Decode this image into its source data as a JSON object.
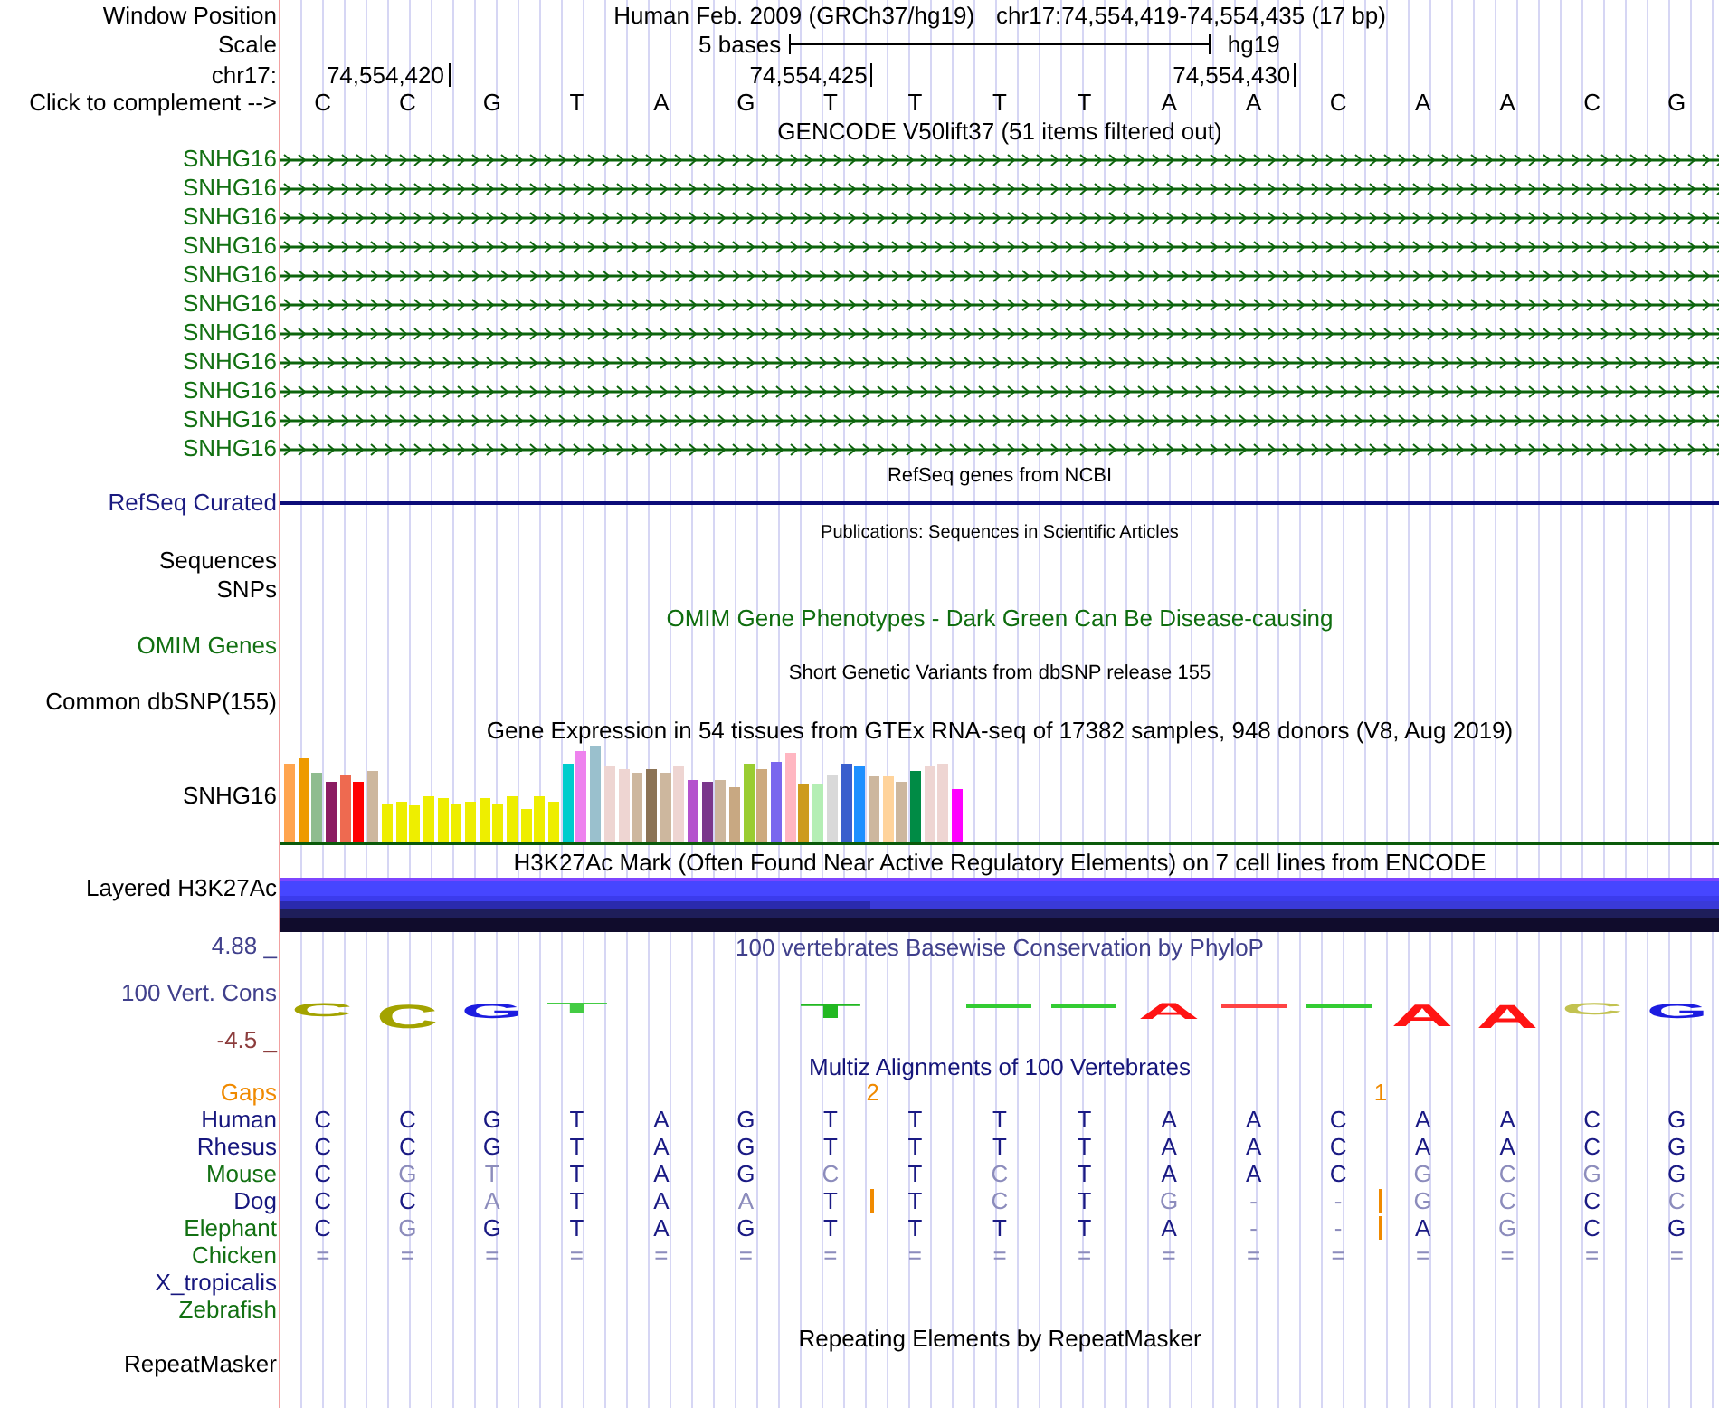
{
  "header": {
    "window_position": {
      "label": "Window Position",
      "assembly": "Human Feb. 2009 (GRCh37/hg19)",
      "range": "chr17:74,554,419-74,554,435 (17 bp)"
    },
    "scale": {
      "label": "Scale",
      "span": "5 bases",
      "assembly": "hg19"
    },
    "coordinates": {
      "label": "chr17:",
      "ticks": [
        "74,554,420",
        "74,554,425",
        "74,554,430"
      ]
    },
    "sequence": {
      "label": "Click to complement -->",
      "bases": [
        "C",
        "C",
        "G",
        "T",
        "A",
        "G",
        "T",
        "T",
        "T",
        "T",
        "A",
        "A",
        "C",
        "A",
        "A",
        "C",
        "G"
      ]
    }
  },
  "tracks": [
    {
      "kind": "gencode",
      "title": "GENCODE V50lift37 (51 items filtered out)",
      "items": [
        {
          "label": "SNHG16",
          "reverse_strand": false
        },
        {
          "label": "SNHG16",
          "reverse_strand": false
        },
        {
          "label": "SNHG16",
          "reverse_strand": false
        },
        {
          "label": "SNHG16",
          "reverse_strand": false
        },
        {
          "label": "SNHG16",
          "reverse_strand": false
        },
        {
          "label": "SNHG16",
          "reverse_strand": false
        },
        {
          "label": "SNHG16",
          "reverse_strand": false
        },
        {
          "label": "SNHG16",
          "reverse_strand": false
        },
        {
          "label": "SNHG16",
          "reverse_strand": false
        },
        {
          "label": "SNHG16",
          "reverse_strand": false
        },
        {
          "label": "SNHG16",
          "reverse_strand": false
        }
      ]
    },
    {
      "kind": "refseq",
      "title": "RefSeq genes from NCBI",
      "labels": [
        "RefSeq Curated"
      ]
    },
    {
      "kind": "pubs",
      "title": "Publications: Sequences in Scientific Articles",
      "labels": [
        "Sequences",
        "SNPs"
      ]
    },
    {
      "kind": "omim",
      "title": "OMIM Gene Phenotypes - Dark Green Can Be Disease-causing",
      "labels": [
        "OMIM Genes"
      ]
    },
    {
      "kind": "dbsnp",
      "title": "Short Genetic Variants from dbSNP release 155",
      "labels": [
        "Common dbSNP(155)"
      ]
    },
    {
      "kind": "gtex",
      "title": "Gene Expression in 54 tissues from GTEx RNA-seq of 17382 samples, 948 donors (V8, Aug 2019)",
      "labels": [
        "SNHG16"
      ]
    },
    {
      "kind": "encode",
      "title": "H3K27Ac Mark (Often Found Near Active Regulatory Elements) on 7 cell lines from ENCODE",
      "labels": [
        "Layered H3K27Ac"
      ]
    },
    {
      "kind": "phylop",
      "title": "100 vertebrates Basewise Conservation by PhyloP",
      "labels": [
        "100 Vert. Cons"
      ],
      "y_max": "4.88 _",
      "y_min": "-4.5 _",
      "logo": [
        {
          "kind": "letter",
          "base": "C",
          "color": "#a3a300"
        },
        {
          "kind": "letter",
          "base": "C",
          "color": "#a3a300"
        },
        {
          "kind": "letter",
          "base": "G",
          "color": "#1c1ce0"
        },
        {
          "kind": "letter",
          "base": "T",
          "color": "#44cc44"
        },
        {
          "kind": "none"
        },
        {
          "kind": "none"
        },
        {
          "kind": "letter",
          "base": "T",
          "color": "#22b822"
        },
        {
          "kind": "none"
        },
        {
          "kind": "dash",
          "color": "#33cc33"
        },
        {
          "kind": "dash",
          "color": "#33cc33"
        },
        {
          "kind": "letter",
          "base": "A",
          "color": "#ff1414"
        },
        {
          "kind": "dash",
          "color": "#ff4444"
        },
        {
          "kind": "dash",
          "color": "#33cc33"
        },
        {
          "kind": "letter",
          "base": "A",
          "color": "#ff1414"
        },
        {
          "kind": "letter",
          "base": "A",
          "color": "#ff1414"
        },
        {
          "kind": "letter",
          "base": "C",
          "color": "#c2c250"
        },
        {
          "kind": "letter",
          "base": "G",
          "color": "#1c1ce0"
        }
      ]
    },
    {
      "kind": "multiz",
      "title": "Multiz Alignments of 100 Vertebrates",
      "gaps": {
        "label": "Gaps",
        "slots": [
          {
            "kind": "none"
          },
          {
            "kind": "none"
          },
          {
            "kind": "none"
          },
          {
            "kind": "none"
          },
          {
            "kind": "none"
          },
          {
            "kind": "none"
          },
          {
            "kind": "count",
            "text": "2"
          },
          {
            "kind": "none"
          },
          {
            "kind": "none"
          },
          {
            "kind": "none"
          },
          {
            "kind": "none"
          },
          {
            "kind": "none"
          },
          {
            "kind": "count",
            "text": "1"
          },
          {
            "kind": "none"
          },
          {
            "kind": "none"
          },
          {
            "kind": "none"
          },
          {
            "kind": "none"
          }
        ]
      },
      "species": [
        {
          "name": "Human",
          "color": "#16167e",
          "bases": [
            {
              "base": "C",
              "match": true,
              "insertion_after": false
            },
            {
              "base": "C",
              "match": true,
              "insertion_after": false
            },
            {
              "base": "G",
              "match": true,
              "insertion_after": false
            },
            {
              "base": "T",
              "match": true,
              "insertion_after": false
            },
            {
              "base": "A",
              "match": true,
              "insertion_after": false
            },
            {
              "base": "G",
              "match": true,
              "insertion_after": false
            },
            {
              "base": "T",
              "match": true,
              "insertion_after": false
            },
            {
              "base": "T",
              "match": true,
              "insertion_after": false
            },
            {
              "base": "T",
              "match": true,
              "insertion_after": false
            },
            {
              "base": "T",
              "match": true,
              "insertion_after": false
            },
            {
              "base": "A",
              "match": true,
              "insertion_after": false
            },
            {
              "base": "A",
              "match": true,
              "insertion_after": false
            },
            {
              "base": "C",
              "match": true,
              "insertion_after": false
            },
            {
              "base": "A",
              "match": true,
              "insertion_after": false
            },
            {
              "base": "A",
              "match": true,
              "insertion_after": false
            },
            {
              "base": "C",
              "match": true,
              "insertion_after": false
            },
            {
              "base": "G",
              "match": true,
              "insertion_after": false
            }
          ]
        },
        {
          "name": "Rhesus",
          "color": "#16167e",
          "bases": [
            {
              "base": "C",
              "match": true,
              "insertion_after": false
            },
            {
              "base": "C",
              "match": true,
              "insertion_after": false
            },
            {
              "base": "G",
              "match": true,
              "insertion_after": false
            },
            {
              "base": "T",
              "match": true,
              "insertion_after": false
            },
            {
              "base": "A",
              "match": true,
              "insertion_after": false
            },
            {
              "base": "G",
              "match": true,
              "insertion_after": false
            },
            {
              "base": "T",
              "match": true,
              "insertion_after": false
            },
            {
              "base": "T",
              "match": true,
              "insertion_after": false
            },
            {
              "base": "T",
              "match": true,
              "insertion_after": false
            },
            {
              "base": "T",
              "match": true,
              "insertion_after": false
            },
            {
              "base": "A",
              "match": true,
              "insertion_after": false
            },
            {
              "base": "A",
              "match": true,
              "insertion_after": false
            },
            {
              "base": "C",
              "match": true,
              "insertion_after": false
            },
            {
              "base": "A",
              "match": true,
              "insertion_after": false
            },
            {
              "base": "A",
              "match": true,
              "insertion_after": false
            },
            {
              "base": "C",
              "match": true,
              "insertion_after": false
            },
            {
              "base": "G",
              "match": true,
              "insertion_after": false
            }
          ]
        },
        {
          "name": "Mouse",
          "color": "#127012",
          "bases": [
            {
              "base": "C",
              "match": true,
              "insertion_after": false
            },
            {
              "base": "G",
              "match": false,
              "insertion_after": false
            },
            {
              "base": "T",
              "match": false,
              "insertion_after": false
            },
            {
              "base": "T",
              "match": true,
              "insertion_after": false
            },
            {
              "base": "A",
              "match": true,
              "insertion_after": false
            },
            {
              "base": "G",
              "match": true,
              "insertion_after": false
            },
            {
              "base": "C",
              "match": false,
              "insertion_after": false
            },
            {
              "base": "T",
              "match": true,
              "insertion_after": false
            },
            {
              "base": "C",
              "match": false,
              "insertion_after": false
            },
            {
              "base": "T",
              "match": true,
              "insertion_after": false
            },
            {
              "base": "A",
              "match": true,
              "insertion_after": false
            },
            {
              "base": "A",
              "match": true,
              "insertion_after": false
            },
            {
              "base": "C",
              "match": true,
              "insertion_after": false
            },
            {
              "base": "G",
              "match": false,
              "insertion_after": false
            },
            {
              "base": "C",
              "match": false,
              "insertion_after": false
            },
            {
              "base": "G",
              "match": false,
              "insertion_after": false
            },
            {
              "base": "G",
              "match": true,
              "insertion_after": false
            }
          ]
        },
        {
          "name": "Dog",
          "color": "#16167e",
          "bases": [
            {
              "base": "C",
              "match": true,
              "insertion_after": false
            },
            {
              "base": "C",
              "match": true,
              "insertion_after": false
            },
            {
              "base": "A",
              "match": false,
              "insertion_after": false
            },
            {
              "base": "T",
              "match": true,
              "insertion_after": false
            },
            {
              "base": "A",
              "match": true,
              "insertion_after": false
            },
            {
              "base": "A",
              "match": false,
              "insertion_after": false
            },
            {
              "base": "T",
              "match": true,
              "insertion_after": true
            },
            {
              "base": "T",
              "match": true,
              "insertion_after": false
            },
            {
              "base": "C",
              "match": false,
              "insertion_after": false
            },
            {
              "base": "T",
              "match": true,
              "insertion_after": false
            },
            {
              "base": "G",
              "match": false,
              "insertion_after": false
            },
            {
              "base": "-",
              "match": false,
              "insertion_after": false
            },
            {
              "base": "-",
              "match": false,
              "insertion_after": true
            },
            {
              "base": "G",
              "match": false,
              "insertion_after": false
            },
            {
              "base": "C",
              "match": false,
              "insertion_after": false
            },
            {
              "base": "C",
              "match": true,
              "insertion_after": false
            },
            {
              "base": "C",
              "match": false,
              "insertion_after": false
            }
          ]
        },
        {
          "name": "Elephant",
          "color": "#127012",
          "bases": [
            {
              "base": "C",
              "match": true,
              "insertion_after": false
            },
            {
              "base": "G",
              "match": false,
              "insertion_after": false
            },
            {
              "base": "G",
              "match": true,
              "insertion_after": false
            },
            {
              "base": "T",
              "match": true,
              "insertion_after": false
            },
            {
              "base": "A",
              "match": true,
              "insertion_after": false
            },
            {
              "base": "G",
              "match": true,
              "insertion_after": false
            },
            {
              "base": "T",
              "match": true,
              "insertion_after": false
            },
            {
              "base": "T",
              "match": true,
              "insertion_after": false
            },
            {
              "base": "T",
              "match": true,
              "insertion_after": false
            },
            {
              "base": "T",
              "match": true,
              "insertion_after": false
            },
            {
              "base": "A",
              "match": true,
              "insertion_after": false
            },
            {
              "base": "-",
              "match": false,
              "insertion_after": false
            },
            {
              "base": "-",
              "match": false,
              "insertion_after": true
            },
            {
              "base": "A",
              "match": true,
              "insertion_after": false
            },
            {
              "base": "G",
              "match": false,
              "insertion_after": false
            },
            {
              "base": "C",
              "match": true,
              "insertion_after": false
            },
            {
              "base": "G",
              "match": true,
              "insertion_after": false
            }
          ]
        },
        {
          "name": "Chicken",
          "color": "#127012",
          "bases": [
            {
              "base": "=",
              "match": false,
              "insertion_after": false
            },
            {
              "base": "=",
              "match": false,
              "insertion_after": false
            },
            {
              "base": "=",
              "match": false,
              "insertion_after": false
            },
            {
              "base": "=",
              "match": false,
              "insertion_after": false
            },
            {
              "base": "=",
              "match": false,
              "insertion_after": false
            },
            {
              "base": "=",
              "match": false,
              "insertion_after": false
            },
            {
              "base": "=",
              "match": false,
              "insertion_after": false
            },
            {
              "base": "=",
              "match": false,
              "insertion_after": false
            },
            {
              "base": "=",
              "match": false,
              "insertion_after": false
            },
            {
              "base": "=",
              "match": false,
              "insertion_after": false
            },
            {
              "base": "=",
              "match": false,
              "insertion_after": false
            },
            {
              "base": "=",
              "match": false,
              "insertion_after": false
            },
            {
              "base": "=",
              "match": false,
              "insertion_after": false
            },
            {
              "base": "=",
              "match": false,
              "insertion_after": false
            },
            {
              "base": "=",
              "match": false,
              "insertion_after": false
            },
            {
              "base": "=",
              "match": false,
              "insertion_after": false
            },
            {
              "base": "=",
              "match": false,
              "insertion_after": false
            }
          ]
        },
        {
          "name": "X_tropicalis",
          "color": "#16167e"
        },
        {
          "name": "Zebrafish",
          "color": "#127012"
        }
      ]
    },
    {
      "kind": "rmsk",
      "title": "Repeating Elements by RepeatMasker",
      "labels": [
        "RepeatMasker"
      ]
    }
  ]
}
